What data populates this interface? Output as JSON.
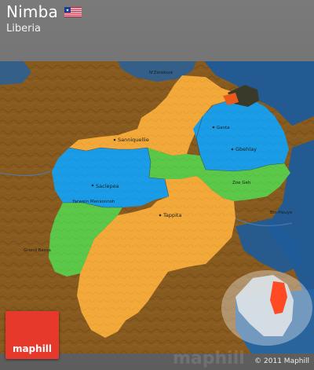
{
  "header": {
    "title": "Nimba",
    "subtitle": "Liberia",
    "flag_icon": "liberia-flag-icon"
  },
  "map": {
    "colors": {
      "region_orange": "#f3a93b",
      "region_blue": "#169be6",
      "region_green": "#5cc84a",
      "outside_blue": "#1f5fa0",
      "terrain_brown": "#8a5a1e",
      "inset_highlight": "#ff4a24"
    },
    "labels": [
      {
        "key": "sanniquellie",
        "text": "Sanniquellie"
      },
      {
        "key": "saclepea",
        "text": "Saclepea"
      },
      {
        "key": "gbehlay",
        "text": "Gbehlay"
      },
      {
        "key": "tappita",
        "text": "Tappita"
      },
      {
        "key": "zoegeh",
        "text": "Zoe Geh"
      },
      {
        "key": "yarwein",
        "text": "Yarwein Mensonnoh"
      },
      {
        "key": "nzerekore",
        "text": "N'Zérékoré"
      },
      {
        "key": "ganta",
        "text": "Ganta"
      },
      {
        "key": "binhouye",
        "text": "Bin-Houye"
      },
      {
        "key": "grandbassa",
        "text": "Grand Bassa"
      }
    ]
  },
  "branding": {
    "logo_text": "maphill",
    "watermark": "maphill",
    "copyright": "© 2011 Maphill"
  }
}
